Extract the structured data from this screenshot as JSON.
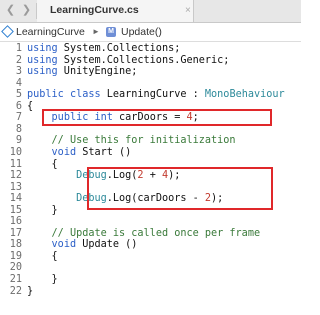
{
  "tabbar": {
    "back_icon": "chevron-left-icon",
    "forward_icon": "chevron-right-icon",
    "active_tab": "LearningCurve.cs",
    "close_glyph": "×"
  },
  "breadcrumb": {
    "class_label": "LearningCurve",
    "separator": "►",
    "method_label": "Update()",
    "method_icon_glyph": "M"
  },
  "editor": {
    "lines": [
      {
        "n": "1",
        "text": "using System.Collections;"
      },
      {
        "n": "2",
        "text": "using System.Collections.Generic;"
      },
      {
        "n": "3",
        "text": "using UnityEngine;"
      },
      {
        "n": "4",
        "text": ""
      },
      {
        "n": "5",
        "text": "public class LearningCurve : MonoBehaviour"
      },
      {
        "n": "6",
        "text": "{"
      },
      {
        "n": "7",
        "text": "    public int carDoors = 4;"
      },
      {
        "n": "8",
        "text": ""
      },
      {
        "n": "9",
        "text": "    // Use this for initialization"
      },
      {
        "n": "10",
        "text": "    void Start ()"
      },
      {
        "n": "11",
        "text": "    {"
      },
      {
        "n": "12",
        "text": "        Debug.Log(2 + 4);"
      },
      {
        "n": "13",
        "text": ""
      },
      {
        "n": "14",
        "text": "        Debug.Log(carDoors - 2);"
      },
      {
        "n": "15",
        "text": "    }"
      },
      {
        "n": "16",
        "text": ""
      },
      {
        "n": "17",
        "text": "    // Update is called once per frame"
      },
      {
        "n": "18",
        "text": "    void Update ()"
      },
      {
        "n": "19",
        "text": "    {"
      },
      {
        "n": "20",
        "text": ""
      },
      {
        "n": "21",
        "text": "    }"
      },
      {
        "n": "22",
        "text": "}"
      }
    ]
  },
  "colors": {
    "keyword": "#2b5fc7",
    "comment": "#3a7a3a",
    "type": "#2d8a9a",
    "number": "#c23a2e",
    "highlight_box": "#e0282a"
  }
}
